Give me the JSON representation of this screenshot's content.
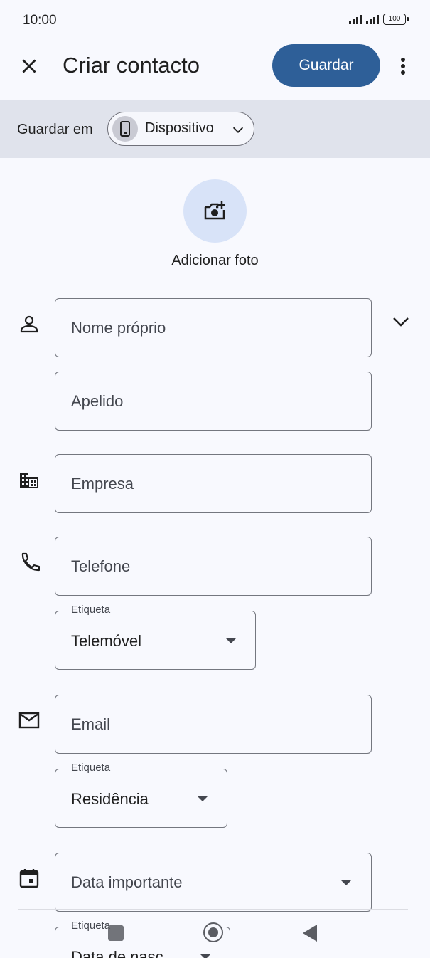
{
  "status_bar": {
    "time": "10:00",
    "battery": "100"
  },
  "appbar": {
    "title": "Criar contacto",
    "save_label": "Guardar"
  },
  "save_in": {
    "label": "Guardar em",
    "location": "Dispositivo"
  },
  "photo": {
    "label": "Adicionar foto"
  },
  "fields": {
    "first_name": {
      "placeholder": "Nome próprio"
    },
    "last_name": {
      "placeholder": "Apelido"
    },
    "company": {
      "placeholder": "Empresa"
    },
    "phone": {
      "placeholder": "Telefone"
    },
    "phone_label": {
      "legend": "Etiqueta",
      "value": "Telemóvel"
    },
    "email": {
      "placeholder": "Email"
    },
    "email_label": {
      "legend": "Etiqueta",
      "value": "Residência"
    },
    "date": {
      "placeholder": "Data importante"
    },
    "date_label": {
      "legend": "Etiqueta",
      "value": "Data de nasc."
    }
  },
  "icons": [
    "close-icon",
    "more-vert-icon",
    "phone-device-icon",
    "chevron-down-icon",
    "add-photo-icon",
    "person-icon",
    "business-icon",
    "call-icon",
    "mail-icon",
    "event-icon",
    "expand-icon",
    "dropdown-arrow-icon",
    "nav-recents-icon",
    "nav-home-icon",
    "nav-back-icon"
  ],
  "colors": {
    "accent": "#2e5f98",
    "strip": "#e0e3ec",
    "photo_bg": "#d8e3f8",
    "background": "#f8f9fe"
  }
}
